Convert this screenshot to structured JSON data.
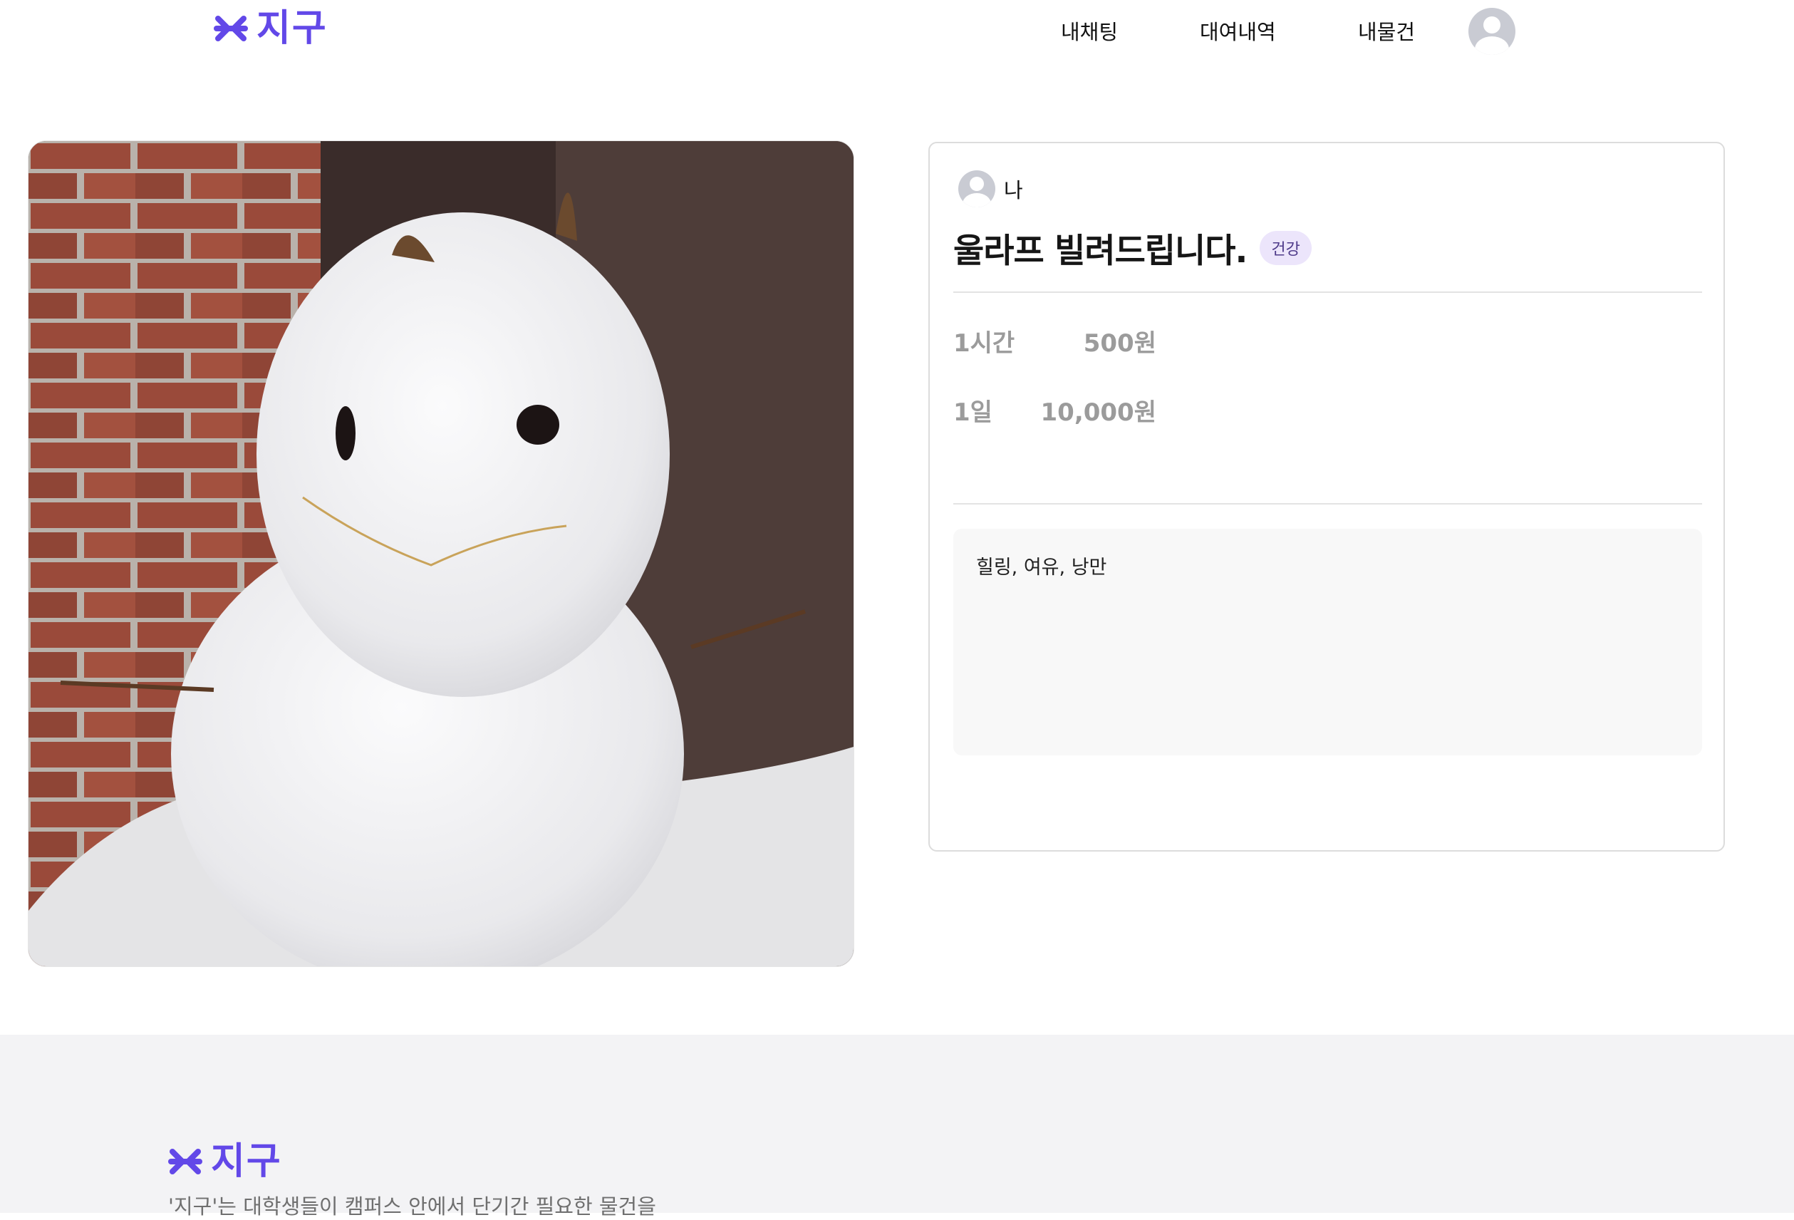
{
  "header": {
    "logo_text": "지구",
    "nav": {
      "my_chat": "내채팅",
      "rental_history": "대여내역",
      "my_items": "내물건"
    },
    "profile_icon": "user-avatar-icon"
  },
  "item": {
    "photo_icon": "snowman-photo",
    "owner_name": "나",
    "title": "울라프 빌려드립니다.",
    "category_badge": "건강",
    "prices": [
      {
        "unit": "1시간",
        "price": "500원"
      },
      {
        "unit": "1일",
        "price": "10,000원"
      }
    ],
    "description": "힐링, 여유, 낭만"
  },
  "footer": {
    "logo_text": "지구",
    "tagline": "'지구'는 대학생들이 캠퍼스 안에서 단기간 필요한 물건을"
  },
  "colors": {
    "brand": "#6248e8",
    "badge_bg": "#ece5fb",
    "footer_bg": "#f3f3f5"
  }
}
